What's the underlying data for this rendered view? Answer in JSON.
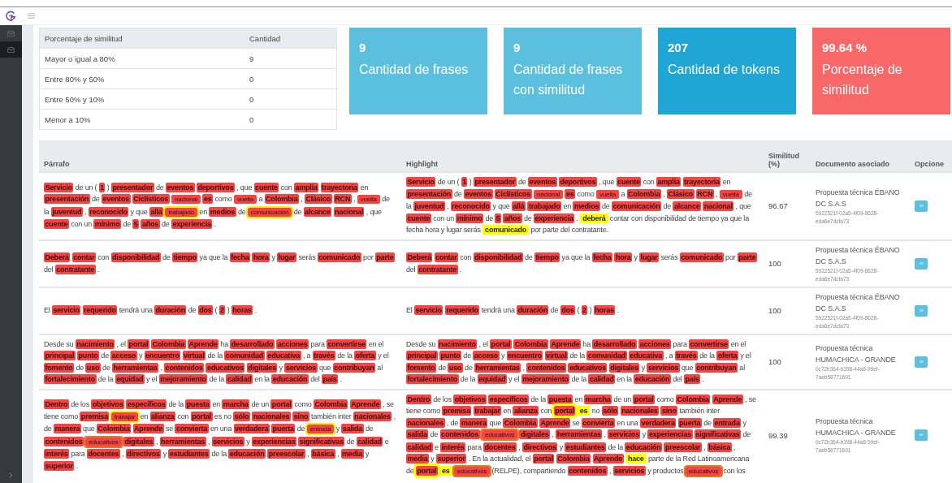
{
  "sidebar": {
    "items": [
      {
        "selected": false
      },
      {
        "selected": true
      }
    ]
  },
  "similarity_summary": {
    "columns": [
      "Porcentaje de similitud",
      "Cantidad"
    ],
    "rows": [
      [
        "Mayor o igual a 80%",
        "9"
      ],
      [
        "Entre 80% y 50%",
        "0"
      ],
      [
        "Entre 50% y 10%",
        "0"
      ],
      [
        "Menor a 10%",
        "0"
      ]
    ]
  },
  "stats_cards": [
    {
      "value": "9",
      "label": "Cantidad de frases",
      "color": "#5bc0de"
    },
    {
      "value": "9",
      "label": "Cantidad de frases con similitud",
      "color": "#5bc0de"
    },
    {
      "value": "207",
      "label": "Cantidad de tokens",
      "color": "#1fa6d4"
    },
    {
      "value": "99.64 %",
      "label": "Porcentaje de similitud",
      "color": "#f96868"
    }
  ],
  "results": {
    "columns": [
      "Párrafo",
      "Highlight",
      "Similitud (%)",
      "Documento asociado",
      "Opcione"
    ],
    "rows": [
      {
        "paragraph": [
          {
            "text": "Servicio",
            "kind": "match"
          },
          {
            "text": "de un (",
            "kind": "plain"
          },
          {
            "text": "1",
            "kind": "match"
          },
          {
            "text": ")",
            "kind": "plain"
          },
          {
            "text": "presentador",
            "kind": "match"
          },
          {
            "text": "de",
            "kind": "plain"
          },
          {
            "text": "eventos",
            "kind": "match"
          },
          {
            "text": "deportivos",
            "kind": "match"
          },
          {
            "text": ", que",
            "kind": "plain"
          },
          {
            "text": "cuente",
            "kind": "match"
          },
          {
            "text": "con",
            "kind": "plain"
          },
          {
            "text": "amplia",
            "kind": "match"
          },
          {
            "text": "trayectoria",
            "kind": "match"
          },
          {
            "text": "en",
            "kind": "plain"
          },
          {
            "text": "presentación",
            "kind": "match"
          },
          {
            "text": "de",
            "kind": "plain"
          },
          {
            "text": "eventos",
            "kind": "match"
          },
          {
            "text": "Ciclísticos",
            "kind": "match"
          },
          {
            "text": "nacional",
            "kind": "match-light"
          },
          {
            "text": "es",
            "kind": "match"
          },
          {
            "text": "como",
            "kind": "plain"
          },
          {
            "text": "vuelta",
            "kind": "match-light"
          },
          {
            "text": "a",
            "kind": "plain"
          },
          {
            "text": "Colombia",
            "kind": "match"
          },
          {
            "text": ",",
            "kind": "plain"
          },
          {
            "text": "Clásico",
            "kind": "match"
          },
          {
            "text": "RCN",
            "kind": "match"
          },
          {
            "text": ",",
            "kind": "plain"
          },
          {
            "text": "vuelta",
            "kind": "match-light"
          },
          {
            "text": "de la",
            "kind": "plain"
          },
          {
            "text": "juventud",
            "kind": "match"
          },
          {
            "text": ",",
            "kind": "plain"
          },
          {
            "text": "reconocido",
            "kind": "match"
          },
          {
            "text": "y que",
            "kind": "plain"
          },
          {
            "text": "allá",
            "kind": "match"
          },
          {
            "text": "trabajado",
            "kind": "match-ring-yellow"
          },
          {
            "text": "en",
            "kind": "plain"
          },
          {
            "text": "medios",
            "kind": "match"
          },
          {
            "text": "de",
            "kind": "plain"
          },
          {
            "text": "comunicación",
            "kind": "match-ring-yellow"
          },
          {
            "text": "de",
            "kind": "plain"
          },
          {
            "text": "alcance",
            "kind": "match"
          },
          {
            "text": "nacional",
            "kind": "match"
          },
          {
            "text": ", que",
            "kind": "plain"
          },
          {
            "text": "cuente",
            "kind": "match"
          },
          {
            "text": "con un",
            "kind": "plain"
          },
          {
            "text": "mínimo",
            "kind": "match"
          },
          {
            "text": "de",
            "kind": "plain"
          },
          {
            "text": "5",
            "kind": "match"
          },
          {
            "text": "años",
            "kind": "match"
          },
          {
            "text": "de",
            "kind": "plain"
          },
          {
            "text": "experiencia",
            "kind": "match"
          },
          {
            "text": ".",
            "kind": "plain"
          }
        ],
        "highlight": [
          {
            "text": "Servicio",
            "kind": "match"
          },
          {
            "text": "de un (",
            "kind": "plain"
          },
          {
            "text": "1",
            "kind": "match"
          },
          {
            "text": ")",
            "kind": "plain"
          },
          {
            "text": "presentador",
            "kind": "match"
          },
          {
            "text": "de",
            "kind": "plain"
          },
          {
            "text": "eventos",
            "kind": "match"
          },
          {
            "text": "deportivos",
            "kind": "match"
          },
          {
            "text": ", que",
            "kind": "plain"
          },
          {
            "text": "cuente",
            "kind": "match"
          },
          {
            "text": "con",
            "kind": "plain"
          },
          {
            "text": "amplia",
            "kind": "match"
          },
          {
            "text": "trayectoria",
            "kind": "match"
          },
          {
            "text": "en",
            "kind": "plain"
          },
          {
            "text": "presentación",
            "kind": "match"
          },
          {
            "text": "de",
            "kind": "plain"
          },
          {
            "text": "eventos",
            "kind": "match"
          },
          {
            "text": "Ciclísticos",
            "kind": "match"
          },
          {
            "text": "nacional",
            "kind": "match-light"
          },
          {
            "text": "es",
            "kind": "match"
          },
          {
            "text": "como",
            "kind": "plain"
          },
          {
            "text": "vuelta",
            "kind": "match-light"
          },
          {
            "text": "a",
            "kind": "plain"
          },
          {
            "text": "Colombia",
            "kind": "match"
          },
          {
            "text": ",",
            "kind": "plain"
          },
          {
            "text": "Clásico",
            "kind": "match"
          },
          {
            "text": "RCN",
            "kind": "match"
          },
          {
            "text": ",",
            "kind": "plain"
          },
          {
            "text": "vuelta",
            "kind": "match-light"
          },
          {
            "text": "de la",
            "kind": "plain"
          },
          {
            "text": "juventud",
            "kind": "match"
          },
          {
            "text": ",",
            "kind": "plain"
          },
          {
            "text": "reconocido",
            "kind": "match"
          },
          {
            "text": "y que",
            "kind": "plain"
          },
          {
            "text": "allá",
            "kind": "match"
          },
          {
            "text": "trabajado",
            "kind": "match"
          },
          {
            "text": "en",
            "kind": "plain"
          },
          {
            "text": "medios",
            "kind": "match"
          },
          {
            "text": "de",
            "kind": "plain"
          },
          {
            "text": "comunicación",
            "kind": "match"
          },
          {
            "text": "de",
            "kind": "plain"
          },
          {
            "text": "alcance",
            "kind": "match"
          },
          {
            "text": "nacional",
            "kind": "match"
          },
          {
            "text": ", que",
            "kind": "plain"
          },
          {
            "text": "cuente",
            "kind": "match"
          },
          {
            "text": "con un",
            "kind": "plain"
          },
          {
            "text": "mínimo",
            "kind": "match"
          },
          {
            "text": "de",
            "kind": "plain"
          },
          {
            "text": "5",
            "kind": "match"
          },
          {
            "text": "años",
            "kind": "match"
          },
          {
            "text": "de",
            "kind": "plain"
          },
          {
            "text": "experiencia",
            "kind": "match"
          },
          {
            "text": ".",
            "kind": "plain"
          },
          {
            "text": "deberá",
            "kind": "new"
          },
          {
            "text": "contar con disponibilidad de tiempo ya que la fecha hora y lugar serás",
            "kind": "plain"
          },
          {
            "text": "comunicado",
            "kind": "new"
          },
          {
            "text": "por parte del contratante.",
            "kind": "plain"
          }
        ],
        "similarity": "96.67",
        "document": "Propuesta técnica ÉBANO DC S.A.S",
        "document_id": "5922521f-02a5-4f09-8628-eda6e7dcfa73"
      },
      {
        "paragraph": [
          {
            "text": "Deberá",
            "kind": "match"
          },
          {
            "text": "contar",
            "kind": "match"
          },
          {
            "text": "con",
            "kind": "plain"
          },
          {
            "text": "disponibilidad",
            "kind": "match"
          },
          {
            "text": "de",
            "kind": "plain"
          },
          {
            "text": "tiempo",
            "kind": "match"
          },
          {
            "text": "ya que la",
            "kind": "plain"
          },
          {
            "text": "fecha",
            "kind": "match"
          },
          {
            "text": "hora",
            "kind": "match"
          },
          {
            "text": "y",
            "kind": "plain"
          },
          {
            "text": "lugar",
            "kind": "match"
          },
          {
            "text": "serás",
            "kind": "plain"
          },
          {
            "text": "comunicado",
            "kind": "match"
          },
          {
            "text": "por",
            "kind": "plain"
          },
          {
            "text": "parte",
            "kind": "match"
          },
          {
            "text": "del",
            "kind": "plain"
          },
          {
            "text": "contratante",
            "kind": "match"
          },
          {
            "text": ".",
            "kind": "plain"
          }
        ],
        "highlight": [
          {
            "text": "Deberá",
            "kind": "match"
          },
          {
            "text": "contar",
            "kind": "match"
          },
          {
            "text": "con",
            "kind": "plain"
          },
          {
            "text": "disponibilidad",
            "kind": "match"
          },
          {
            "text": "de",
            "kind": "plain"
          },
          {
            "text": "tiempo",
            "kind": "match"
          },
          {
            "text": "ya que la",
            "kind": "plain"
          },
          {
            "text": "fecha",
            "kind": "match"
          },
          {
            "text": "hora",
            "kind": "match"
          },
          {
            "text": "y",
            "kind": "plain"
          },
          {
            "text": "lugar",
            "kind": "match"
          },
          {
            "text": "serás",
            "kind": "plain"
          },
          {
            "text": "comunicado",
            "kind": "match"
          },
          {
            "text": "por",
            "kind": "plain"
          },
          {
            "text": "parte",
            "kind": "match"
          },
          {
            "text": "del",
            "kind": "plain"
          },
          {
            "text": "contratante",
            "kind": "match"
          },
          {
            "text": ".",
            "kind": "plain"
          }
        ],
        "similarity": "100",
        "document": "Propuesta técnica ÉBANO DC S.A.S",
        "document_id": "5922521f-02a5-4f09-8628-eda6e7dcfa73"
      },
      {
        "paragraph": [
          {
            "text": "El",
            "kind": "plain"
          },
          {
            "text": "servicio",
            "kind": "match"
          },
          {
            "text": "requerido",
            "kind": "match"
          },
          {
            "text": "tendrá una",
            "kind": "plain"
          },
          {
            "text": "duración",
            "kind": "match"
          },
          {
            "text": "de",
            "kind": "plain"
          },
          {
            "text": "dos",
            "kind": "match"
          },
          {
            "text": "(",
            "kind": "plain"
          },
          {
            "text": "2",
            "kind": "match"
          },
          {
            "text": ")",
            "kind": "plain"
          },
          {
            "text": "horas",
            "kind": "match"
          },
          {
            "text": ".",
            "kind": "plain"
          }
        ],
        "highlight": [
          {
            "text": "El",
            "kind": "plain"
          },
          {
            "text": "servicio",
            "kind": "match"
          },
          {
            "text": "requerido",
            "kind": "match"
          },
          {
            "text": "tendrá una",
            "kind": "plain"
          },
          {
            "text": "duración",
            "kind": "match"
          },
          {
            "text": "de",
            "kind": "plain"
          },
          {
            "text": "dos",
            "kind": "match"
          },
          {
            "text": "(",
            "kind": "plain"
          },
          {
            "text": "2",
            "kind": "match"
          },
          {
            "text": ")",
            "kind": "plain"
          },
          {
            "text": "horas",
            "kind": "match"
          },
          {
            "text": ".",
            "kind": "plain"
          }
        ],
        "similarity": "100",
        "document": "Propuesta técnica ÉBANO DC S.A.S",
        "document_id": "5922521f-02a5-4f09-8628-eda6e7dcfa73"
      },
      {
        "paragraph": [
          {
            "text": "Desde su",
            "kind": "plain"
          },
          {
            "text": "nacimiento",
            "kind": "match"
          },
          {
            "text": ", el",
            "kind": "plain"
          },
          {
            "text": "portal",
            "kind": "match"
          },
          {
            "text": "Colombia",
            "kind": "match"
          },
          {
            "text": "Aprende",
            "kind": "match"
          },
          {
            "text": "ha",
            "kind": "plain"
          },
          {
            "text": "desarrollado",
            "kind": "match"
          },
          {
            "text": "acciones",
            "kind": "match"
          },
          {
            "text": "para",
            "kind": "plain"
          },
          {
            "text": "convertirse",
            "kind": "match"
          },
          {
            "text": "en el",
            "kind": "plain"
          },
          {
            "text": "principal",
            "kind": "match"
          },
          {
            "text": "punto",
            "kind": "match"
          },
          {
            "text": "de",
            "kind": "plain"
          },
          {
            "text": "acceso",
            "kind": "match"
          },
          {
            "text": "y",
            "kind": "plain"
          },
          {
            "text": "encuentro",
            "kind": "match"
          },
          {
            "text": "virtual",
            "kind": "match"
          },
          {
            "text": "de la",
            "kind": "plain"
          },
          {
            "text": "comunidad",
            "kind": "match"
          },
          {
            "text": "educativa",
            "kind": "match"
          },
          {
            "text": ", a",
            "kind": "plain"
          },
          {
            "text": "través",
            "kind": "match"
          },
          {
            "text": "de la",
            "kind": "plain"
          },
          {
            "text": "oferta",
            "kind": "match"
          },
          {
            "text": "y el",
            "kind": "plain"
          },
          {
            "text": "fomento",
            "kind": "match"
          },
          {
            "text": "de",
            "kind": "plain"
          },
          {
            "text": "uso",
            "kind": "match"
          },
          {
            "text": "de",
            "kind": "plain"
          },
          {
            "text": "herramientas",
            "kind": "match"
          },
          {
            "text": ",",
            "kind": "plain"
          },
          {
            "text": "contenidos",
            "kind": "match"
          },
          {
            "text": "educativos",
            "kind": "match"
          },
          {
            "text": "digitales",
            "kind": "match"
          },
          {
            "text": "y",
            "kind": "plain"
          },
          {
            "text": "servicios",
            "kind": "match"
          },
          {
            "text": "que",
            "kind": "plain"
          },
          {
            "text": "contribuyan",
            "kind": "match"
          },
          {
            "text": "al",
            "kind": "plain"
          },
          {
            "text": "fortalecimiento",
            "kind": "match"
          },
          {
            "text": "de la",
            "kind": "plain"
          },
          {
            "text": "equidad",
            "kind": "match"
          },
          {
            "text": "y el",
            "kind": "plain"
          },
          {
            "text": "mejoramiento",
            "kind": "match"
          },
          {
            "text": "de la",
            "kind": "plain"
          },
          {
            "text": "calidad",
            "kind": "match"
          },
          {
            "text": "en la",
            "kind": "plain"
          },
          {
            "text": "educación",
            "kind": "match"
          },
          {
            "text": "del",
            "kind": "plain"
          },
          {
            "text": "país",
            "kind": "match"
          },
          {
            "text": ".",
            "kind": "plain"
          }
        ],
        "highlight": [
          {
            "text": "Desde su",
            "kind": "plain"
          },
          {
            "text": "nacimiento",
            "kind": "match"
          },
          {
            "text": ", el",
            "kind": "plain"
          },
          {
            "text": "portal",
            "kind": "match"
          },
          {
            "text": "Colombia",
            "kind": "match"
          },
          {
            "text": "Aprende",
            "kind": "match"
          },
          {
            "text": "ha",
            "kind": "plain"
          },
          {
            "text": "desarrollado",
            "kind": "match"
          },
          {
            "text": "acciones",
            "kind": "match"
          },
          {
            "text": "para",
            "kind": "plain"
          },
          {
            "text": "convertirse",
            "kind": "match"
          },
          {
            "text": "en el",
            "kind": "plain"
          },
          {
            "text": "principal",
            "kind": "match"
          },
          {
            "text": "punto",
            "kind": "match"
          },
          {
            "text": "de",
            "kind": "plain"
          },
          {
            "text": "acceso",
            "kind": "match"
          },
          {
            "text": "y",
            "kind": "plain"
          },
          {
            "text": "encuentro",
            "kind": "match"
          },
          {
            "text": "virtual",
            "kind": "match"
          },
          {
            "text": "de la",
            "kind": "plain"
          },
          {
            "text": "comunidad",
            "kind": "match"
          },
          {
            "text": "educativa",
            "kind": "match"
          },
          {
            "text": ", a",
            "kind": "plain"
          },
          {
            "text": "través",
            "kind": "match"
          },
          {
            "text": "de la",
            "kind": "plain"
          },
          {
            "text": "oferta",
            "kind": "match"
          },
          {
            "text": "y el",
            "kind": "plain"
          },
          {
            "text": "fomento",
            "kind": "match"
          },
          {
            "text": "de",
            "kind": "plain"
          },
          {
            "text": "uso",
            "kind": "match"
          },
          {
            "text": "de",
            "kind": "plain"
          },
          {
            "text": "herramientas",
            "kind": "match"
          },
          {
            "text": ",",
            "kind": "plain"
          },
          {
            "text": "contenidos",
            "kind": "match"
          },
          {
            "text": "educativos",
            "kind": "match"
          },
          {
            "text": "digitales",
            "kind": "match"
          },
          {
            "text": "y",
            "kind": "plain"
          },
          {
            "text": "servicios",
            "kind": "match"
          },
          {
            "text": "que",
            "kind": "plain"
          },
          {
            "text": "contribuyan",
            "kind": "match"
          },
          {
            "text": "al",
            "kind": "plain"
          },
          {
            "text": "fortalecimiento",
            "kind": "match"
          },
          {
            "text": "de la",
            "kind": "plain"
          },
          {
            "text": "equidad",
            "kind": "match"
          },
          {
            "text": "y el",
            "kind": "plain"
          },
          {
            "text": "mejoramiento",
            "kind": "match"
          },
          {
            "text": "de la",
            "kind": "plain"
          },
          {
            "text": "calidad",
            "kind": "match"
          },
          {
            "text": "en la",
            "kind": "plain"
          },
          {
            "text": "educación",
            "kind": "match"
          },
          {
            "text": "del",
            "kind": "plain"
          },
          {
            "text": "país",
            "kind": "match"
          },
          {
            "text": ".",
            "kind": "plain"
          }
        ],
        "similarity": "100",
        "document": "Propuesta técnica HUMACHICA - GRANDE",
        "document_id": "0c72b364-b398-44a8-99ef-7aeb58771691"
      },
      {
        "paragraph": [
          {
            "text": "Dentro",
            "kind": "match"
          },
          {
            "text": "de los",
            "kind": "plain"
          },
          {
            "text": "objetivos",
            "kind": "match"
          },
          {
            "text": "específicos",
            "kind": "match"
          },
          {
            "text": "de la",
            "kind": "plain"
          },
          {
            "text": "puesta",
            "kind": "match"
          },
          {
            "text": "en",
            "kind": "plain"
          },
          {
            "text": "marcha",
            "kind": "match"
          },
          {
            "text": "de un",
            "kind": "plain"
          },
          {
            "text": "portal",
            "kind": "match"
          },
          {
            "text": "como",
            "kind": "plain"
          },
          {
            "text": "Colombia",
            "kind": "match"
          },
          {
            "text": "Aprende",
            "kind": "match"
          },
          {
            "text": ", se tiene como",
            "kind": "plain"
          },
          {
            "text": "premisa",
            "kind": "match"
          },
          {
            "text": "trabajar",
            "kind": "match-ring-yellow"
          },
          {
            "text": "en",
            "kind": "plain"
          },
          {
            "text": "alianza",
            "kind": "match"
          },
          {
            "text": "con",
            "kind": "plain"
          },
          {
            "text": "portal",
            "kind": "match"
          },
          {
            "text": "es no",
            "kind": "plain"
          },
          {
            "text": "sólo",
            "kind": "match"
          },
          {
            "text": "nacionales",
            "kind": "match"
          },
          {
            "text": "sino",
            "kind": "match"
          },
          {
            "text": "también inter",
            "kind": "plain"
          },
          {
            "text": "nacionales",
            "kind": "match"
          },
          {
            "text": ", de",
            "kind": "plain"
          },
          {
            "text": "manera",
            "kind": "match"
          },
          {
            "text": "que",
            "kind": "plain"
          },
          {
            "text": "Colombia",
            "kind": "match"
          },
          {
            "text": "Aprende",
            "kind": "match"
          },
          {
            "text": "se",
            "kind": "plain"
          },
          {
            "text": "convierta",
            "kind": "match"
          },
          {
            "text": "en una",
            "kind": "plain"
          },
          {
            "text": "verdadera",
            "kind": "match"
          },
          {
            "text": "puerta",
            "kind": "match"
          },
          {
            "text": "de",
            "kind": "plain"
          },
          {
            "text": "entrada",
            "kind": "match-ring-yellow"
          },
          {
            "text": "y",
            "kind": "plain"
          },
          {
            "text": "salida",
            "kind": "match"
          },
          {
            "text": "de",
            "kind": "plain"
          },
          {
            "text": "contenidos",
            "kind": "match"
          },
          {
            "text": "educativos",
            "kind": "match-ring-orange"
          },
          {
            "text": "digitales",
            "kind": "match"
          },
          {
            "text": ",",
            "kind": "plain"
          },
          {
            "text": "herramientas",
            "kind": "match"
          },
          {
            "text": ",",
            "kind": "plain"
          },
          {
            "text": "servicios",
            "kind": "match"
          },
          {
            "text": "y",
            "kind": "plain"
          },
          {
            "text": "experiencias",
            "kind": "match"
          },
          {
            "text": "significativas",
            "kind": "match"
          },
          {
            "text": "de",
            "kind": "plain"
          },
          {
            "text": "calidad",
            "kind": "match"
          },
          {
            "text": "e",
            "kind": "plain"
          },
          {
            "text": "interés",
            "kind": "match"
          },
          {
            "text": "para",
            "kind": "plain"
          },
          {
            "text": "docentes",
            "kind": "match"
          },
          {
            "text": ",",
            "kind": "plain"
          },
          {
            "text": "directivos",
            "kind": "match"
          },
          {
            "text": "y",
            "kind": "plain"
          },
          {
            "text": "estudiantes",
            "kind": "match"
          },
          {
            "text": "de la",
            "kind": "plain"
          },
          {
            "text": "educación",
            "kind": "match"
          },
          {
            "text": "preescolar",
            "kind": "match"
          },
          {
            "text": ",",
            "kind": "plain"
          },
          {
            "text": "básica",
            "kind": "match"
          },
          {
            "text": ",",
            "kind": "plain"
          },
          {
            "text": "media",
            "kind": "match"
          },
          {
            "text": "y",
            "kind": "plain"
          },
          {
            "text": "superior",
            "kind": "match"
          },
          {
            "text": ".",
            "kind": "plain"
          }
        ],
        "highlight": [
          {
            "text": "Dentro",
            "kind": "match"
          },
          {
            "text": "de los",
            "kind": "plain"
          },
          {
            "text": "objetivos",
            "kind": "match"
          },
          {
            "text": "específicos",
            "kind": "match"
          },
          {
            "text": "de la",
            "kind": "plain"
          },
          {
            "text": "puesta",
            "kind": "match"
          },
          {
            "text": "en",
            "kind": "plain"
          },
          {
            "text": "marcha",
            "kind": "match"
          },
          {
            "text": "de un",
            "kind": "plain"
          },
          {
            "text": "portal",
            "kind": "match"
          },
          {
            "text": "como",
            "kind": "plain"
          },
          {
            "text": "Colombia",
            "kind": "match"
          },
          {
            "text": "Aprende",
            "kind": "match"
          },
          {
            "text": ", se tiene como",
            "kind": "plain"
          },
          {
            "text": "premisa",
            "kind": "match"
          },
          {
            "text": "trabajar",
            "kind": "match"
          },
          {
            "text": "en",
            "kind": "plain"
          },
          {
            "text": "alianza",
            "kind": "match"
          },
          {
            "text": "con",
            "kind": "plain"
          },
          {
            "text": "portal",
            "kind": "match-new"
          },
          {
            "text": "es",
            "kind": "new"
          },
          {
            "text": "no",
            "kind": "plain"
          },
          {
            "text": "sólo",
            "kind": "match"
          },
          {
            "text": "nacionales",
            "kind": "match"
          },
          {
            "text": "sino",
            "kind": "match"
          },
          {
            "text": "también inter",
            "kind": "plain"
          },
          {
            "text": "nacionales",
            "kind": "match"
          },
          {
            "text": ", de",
            "kind": "plain"
          },
          {
            "text": "manera",
            "kind": "match"
          },
          {
            "text": "que",
            "kind": "plain"
          },
          {
            "text": "Colombia",
            "kind": "match"
          },
          {
            "text": "Aprende",
            "kind": "match"
          },
          {
            "text": "se",
            "kind": "plain"
          },
          {
            "text": "convierta",
            "kind": "match"
          },
          {
            "text": "en una",
            "kind": "plain"
          },
          {
            "text": "verdadera",
            "kind": "match"
          },
          {
            "text": "puerta",
            "kind": "match"
          },
          {
            "text": "de",
            "kind": "plain"
          },
          {
            "text": "entrada",
            "kind": "match"
          },
          {
            "text": "y",
            "kind": "plain"
          },
          {
            "text": "salida",
            "kind": "match"
          },
          {
            "text": "de",
            "kind": "plain"
          },
          {
            "text": "contenidos",
            "kind": "match"
          },
          {
            "text": "educativos",
            "kind": "match-ring-orange"
          },
          {
            "text": "digitales",
            "kind": "match"
          },
          {
            "text": ",",
            "kind": "plain"
          },
          {
            "text": "herramientas",
            "kind": "match"
          },
          {
            "text": ",",
            "kind": "plain"
          },
          {
            "text": "servicios",
            "kind": "match"
          },
          {
            "text": "y",
            "kind": "plain"
          },
          {
            "text": "experiencias",
            "kind": "match"
          },
          {
            "text": "significativas",
            "kind": "match"
          },
          {
            "text": "de",
            "kind": "plain"
          },
          {
            "text": "calidad",
            "kind": "match"
          },
          {
            "text": "e",
            "kind": "plain"
          },
          {
            "text": "interés",
            "kind": "match"
          },
          {
            "text": "para",
            "kind": "plain"
          },
          {
            "text": "docentes",
            "kind": "match"
          },
          {
            "text": ",",
            "kind": "plain"
          },
          {
            "text": "directivos",
            "kind": "match"
          },
          {
            "text": "y",
            "kind": "plain"
          },
          {
            "text": "estudiantes",
            "kind": "match"
          },
          {
            "text": "de la",
            "kind": "plain"
          },
          {
            "text": "educación",
            "kind": "match"
          },
          {
            "text": "preescolar",
            "kind": "match"
          },
          {
            "text": ",",
            "kind": "plain"
          },
          {
            "text": "básica",
            "kind": "match"
          },
          {
            "text": ",",
            "kind": "plain"
          },
          {
            "text": "media",
            "kind": "match"
          },
          {
            "text": "y",
            "kind": "plain"
          },
          {
            "text": "superior",
            "kind": "match"
          },
          {
            "text": ". En la actualidad, el",
            "kind": "plain"
          },
          {
            "text": "portal",
            "kind": "match"
          },
          {
            "text": "Colombia",
            "kind": "match"
          },
          {
            "text": "Aprende",
            "kind": "match"
          },
          {
            "text": "hace",
            "kind": "new"
          },
          {
            "text": "parte de la Red Latinoamericana de",
            "kind": "plain"
          },
          {
            "text": "portal",
            "kind": "match-new"
          },
          {
            "text": "es",
            "kind": "new"
          },
          {
            "text": "educativos",
            "kind": "match-ring-orange"
          },
          {
            "text": "(RELPE), compartiendo",
            "kind": "plain"
          },
          {
            "text": "contenidos",
            "kind": "match"
          },
          {
            "text": ",",
            "kind": "plain"
          },
          {
            "text": "servicios",
            "kind": "match"
          },
          {
            "text": "y productos",
            "kind": "plain"
          },
          {
            "text": "educativos",
            "kind": "match-ring-orange"
          },
          {
            "text": "con los",
            "kind": "plain"
          }
        ],
        "similarity": "99.39",
        "document": "Propuesta técnica HUMACHICA - GRANDE",
        "document_id": "0c72b364-b398-44a8-99ef-7aeb58771691"
      }
    ]
  }
}
